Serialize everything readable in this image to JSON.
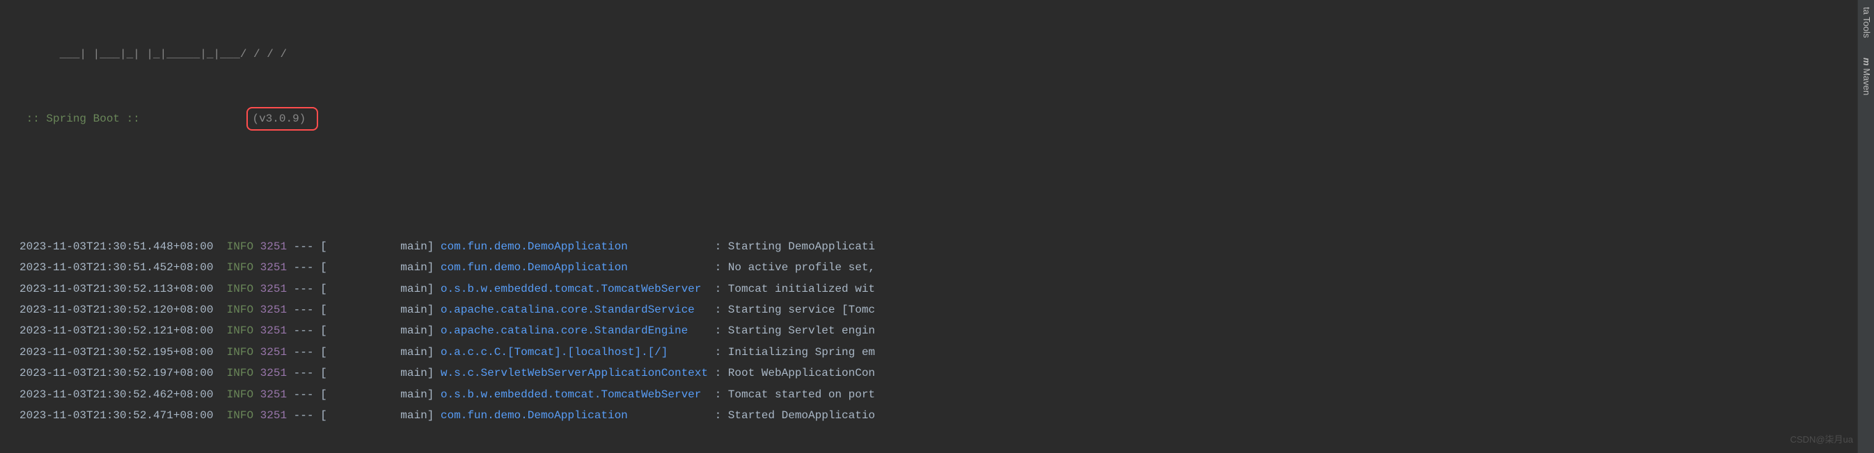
{
  "banner": {
    "ascii_fragment": "      ___| |___|_| |_|_____|_|___/ / / /",
    "label": " :: Spring Boot :: ",
    "version_padding": "               ",
    "version": "(v3.0.9)"
  },
  "logs": [
    {
      "timestamp": "2023-11-03T21:30:51.448+08:00",
      "level": "INFO",
      "pid": "3251",
      "thread": "           main",
      "logger": "com.fun.demo.DemoApplication            ",
      "message": "Starting DemoApplicati"
    },
    {
      "timestamp": "2023-11-03T21:30:51.452+08:00",
      "level": "INFO",
      "pid": "3251",
      "thread": "           main",
      "logger": "com.fun.demo.DemoApplication            ",
      "message": "No active profile set,"
    },
    {
      "timestamp": "2023-11-03T21:30:52.113+08:00",
      "level": "INFO",
      "pid": "3251",
      "thread": "           main",
      "logger": "o.s.b.w.embedded.tomcat.TomcatWebServer ",
      "message": "Tomcat initialized wit"
    },
    {
      "timestamp": "2023-11-03T21:30:52.120+08:00",
      "level": "INFO",
      "pid": "3251",
      "thread": "           main",
      "logger": "o.apache.catalina.core.StandardService  ",
      "message": "Starting service [Tomc"
    },
    {
      "timestamp": "2023-11-03T21:30:52.121+08:00",
      "level": "INFO",
      "pid": "3251",
      "thread": "           main",
      "logger": "o.apache.catalina.core.StandardEngine   ",
      "message": "Starting Servlet engin"
    },
    {
      "timestamp": "2023-11-03T21:30:52.195+08:00",
      "level": "INFO",
      "pid": "3251",
      "thread": "           main",
      "logger": "o.a.c.c.C.[Tomcat].[localhost].[/]      ",
      "message": "Initializing Spring em"
    },
    {
      "timestamp": "2023-11-03T21:30:52.197+08:00",
      "level": "INFO",
      "pid": "3251",
      "thread": "           main",
      "logger": "w.s.c.ServletWebServerApplicationContext",
      "message": "Root WebApplicationCon"
    },
    {
      "timestamp": "2023-11-03T21:30:52.462+08:00",
      "level": "INFO",
      "pid": "3251",
      "thread": "           main",
      "logger": "o.s.b.w.embedded.tomcat.TomcatWebServer ",
      "message": "Tomcat started on port"
    },
    {
      "timestamp": "2023-11-03T21:30:52.471+08:00",
      "level": "INFO",
      "pid": "3251",
      "thread": "           main",
      "logger": "com.fun.demo.DemoApplication            ",
      "message": "Started DemoApplicatio"
    }
  ],
  "tools": {
    "top": "ta Tools",
    "maven": "Maven"
  },
  "watermark": "CSDN@柒月ua"
}
